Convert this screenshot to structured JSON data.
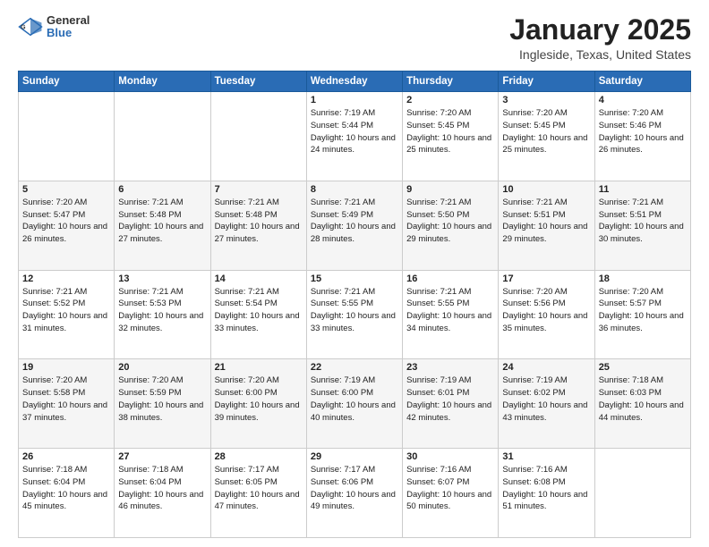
{
  "header": {
    "logo_general": "General",
    "logo_blue": "Blue",
    "title": "January 2025",
    "subtitle": "Ingleside, Texas, United States"
  },
  "days_of_week": [
    "Sunday",
    "Monday",
    "Tuesday",
    "Wednesday",
    "Thursday",
    "Friday",
    "Saturday"
  ],
  "weeks": [
    [
      {
        "day": "",
        "sunrise": "",
        "sunset": "",
        "daylight": ""
      },
      {
        "day": "",
        "sunrise": "",
        "sunset": "",
        "daylight": ""
      },
      {
        "day": "",
        "sunrise": "",
        "sunset": "",
        "daylight": ""
      },
      {
        "day": "1",
        "sunrise": "Sunrise: 7:19 AM",
        "sunset": "Sunset: 5:44 PM",
        "daylight": "Daylight: 10 hours and 24 minutes."
      },
      {
        "day": "2",
        "sunrise": "Sunrise: 7:20 AM",
        "sunset": "Sunset: 5:45 PM",
        "daylight": "Daylight: 10 hours and 25 minutes."
      },
      {
        "day": "3",
        "sunrise": "Sunrise: 7:20 AM",
        "sunset": "Sunset: 5:45 PM",
        "daylight": "Daylight: 10 hours and 25 minutes."
      },
      {
        "day": "4",
        "sunrise": "Sunrise: 7:20 AM",
        "sunset": "Sunset: 5:46 PM",
        "daylight": "Daylight: 10 hours and 26 minutes."
      }
    ],
    [
      {
        "day": "5",
        "sunrise": "Sunrise: 7:20 AM",
        "sunset": "Sunset: 5:47 PM",
        "daylight": "Daylight: 10 hours and 26 minutes."
      },
      {
        "day": "6",
        "sunrise": "Sunrise: 7:21 AM",
        "sunset": "Sunset: 5:48 PM",
        "daylight": "Daylight: 10 hours and 27 minutes."
      },
      {
        "day": "7",
        "sunrise": "Sunrise: 7:21 AM",
        "sunset": "Sunset: 5:48 PM",
        "daylight": "Daylight: 10 hours and 27 minutes."
      },
      {
        "day": "8",
        "sunrise": "Sunrise: 7:21 AM",
        "sunset": "Sunset: 5:49 PM",
        "daylight": "Daylight: 10 hours and 28 minutes."
      },
      {
        "day": "9",
        "sunrise": "Sunrise: 7:21 AM",
        "sunset": "Sunset: 5:50 PM",
        "daylight": "Daylight: 10 hours and 29 minutes."
      },
      {
        "day": "10",
        "sunrise": "Sunrise: 7:21 AM",
        "sunset": "Sunset: 5:51 PM",
        "daylight": "Daylight: 10 hours and 29 minutes."
      },
      {
        "day": "11",
        "sunrise": "Sunrise: 7:21 AM",
        "sunset": "Sunset: 5:51 PM",
        "daylight": "Daylight: 10 hours and 30 minutes."
      }
    ],
    [
      {
        "day": "12",
        "sunrise": "Sunrise: 7:21 AM",
        "sunset": "Sunset: 5:52 PM",
        "daylight": "Daylight: 10 hours and 31 minutes."
      },
      {
        "day": "13",
        "sunrise": "Sunrise: 7:21 AM",
        "sunset": "Sunset: 5:53 PM",
        "daylight": "Daylight: 10 hours and 32 minutes."
      },
      {
        "day": "14",
        "sunrise": "Sunrise: 7:21 AM",
        "sunset": "Sunset: 5:54 PM",
        "daylight": "Daylight: 10 hours and 33 minutes."
      },
      {
        "day": "15",
        "sunrise": "Sunrise: 7:21 AM",
        "sunset": "Sunset: 5:55 PM",
        "daylight": "Daylight: 10 hours and 33 minutes."
      },
      {
        "day": "16",
        "sunrise": "Sunrise: 7:21 AM",
        "sunset": "Sunset: 5:55 PM",
        "daylight": "Daylight: 10 hours and 34 minutes."
      },
      {
        "day": "17",
        "sunrise": "Sunrise: 7:20 AM",
        "sunset": "Sunset: 5:56 PM",
        "daylight": "Daylight: 10 hours and 35 minutes."
      },
      {
        "day": "18",
        "sunrise": "Sunrise: 7:20 AM",
        "sunset": "Sunset: 5:57 PM",
        "daylight": "Daylight: 10 hours and 36 minutes."
      }
    ],
    [
      {
        "day": "19",
        "sunrise": "Sunrise: 7:20 AM",
        "sunset": "Sunset: 5:58 PM",
        "daylight": "Daylight: 10 hours and 37 minutes."
      },
      {
        "day": "20",
        "sunrise": "Sunrise: 7:20 AM",
        "sunset": "Sunset: 5:59 PM",
        "daylight": "Daylight: 10 hours and 38 minutes."
      },
      {
        "day": "21",
        "sunrise": "Sunrise: 7:20 AM",
        "sunset": "Sunset: 6:00 PM",
        "daylight": "Daylight: 10 hours and 39 minutes."
      },
      {
        "day": "22",
        "sunrise": "Sunrise: 7:19 AM",
        "sunset": "Sunset: 6:00 PM",
        "daylight": "Daylight: 10 hours and 40 minutes."
      },
      {
        "day": "23",
        "sunrise": "Sunrise: 7:19 AM",
        "sunset": "Sunset: 6:01 PM",
        "daylight": "Daylight: 10 hours and 42 minutes."
      },
      {
        "day": "24",
        "sunrise": "Sunrise: 7:19 AM",
        "sunset": "Sunset: 6:02 PM",
        "daylight": "Daylight: 10 hours and 43 minutes."
      },
      {
        "day": "25",
        "sunrise": "Sunrise: 7:18 AM",
        "sunset": "Sunset: 6:03 PM",
        "daylight": "Daylight: 10 hours and 44 minutes."
      }
    ],
    [
      {
        "day": "26",
        "sunrise": "Sunrise: 7:18 AM",
        "sunset": "Sunset: 6:04 PM",
        "daylight": "Daylight: 10 hours and 45 minutes."
      },
      {
        "day": "27",
        "sunrise": "Sunrise: 7:18 AM",
        "sunset": "Sunset: 6:04 PM",
        "daylight": "Daylight: 10 hours and 46 minutes."
      },
      {
        "day": "28",
        "sunrise": "Sunrise: 7:17 AM",
        "sunset": "Sunset: 6:05 PM",
        "daylight": "Daylight: 10 hours and 47 minutes."
      },
      {
        "day": "29",
        "sunrise": "Sunrise: 7:17 AM",
        "sunset": "Sunset: 6:06 PM",
        "daylight": "Daylight: 10 hours and 49 minutes."
      },
      {
        "day": "30",
        "sunrise": "Sunrise: 7:16 AM",
        "sunset": "Sunset: 6:07 PM",
        "daylight": "Daylight: 10 hours and 50 minutes."
      },
      {
        "day": "31",
        "sunrise": "Sunrise: 7:16 AM",
        "sunset": "Sunset: 6:08 PM",
        "daylight": "Daylight: 10 hours and 51 minutes."
      },
      {
        "day": "",
        "sunrise": "",
        "sunset": "",
        "daylight": ""
      }
    ]
  ]
}
